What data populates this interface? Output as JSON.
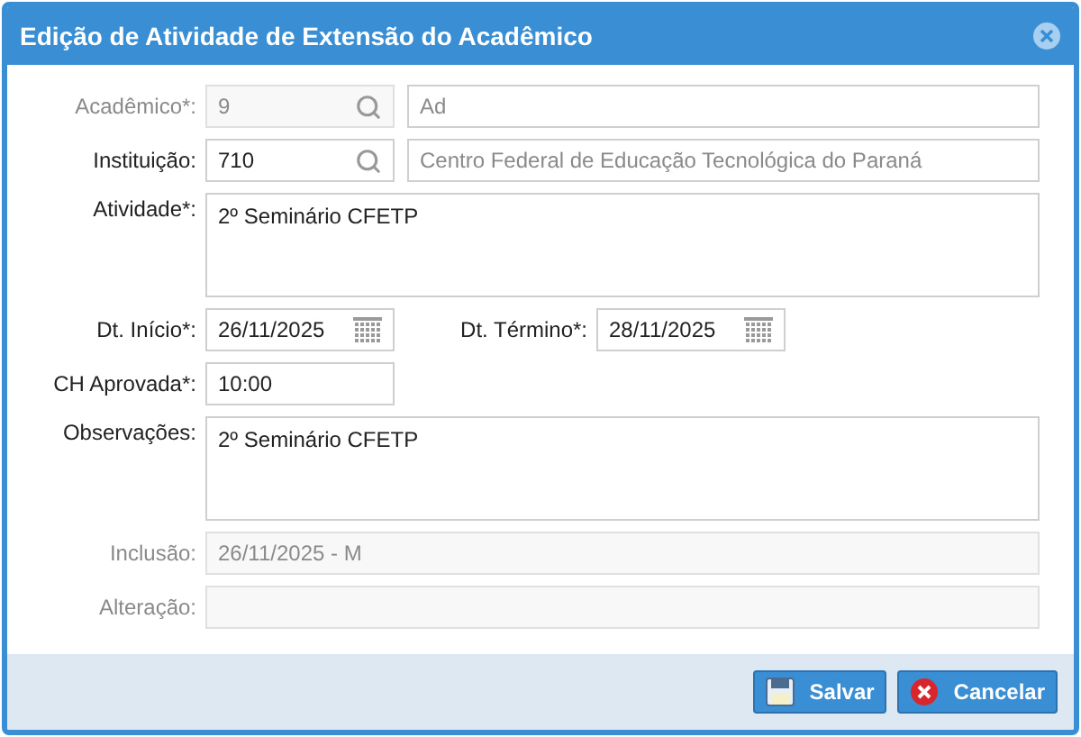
{
  "dialog": {
    "title": "Edição de Atividade de Extensão do Acadêmico"
  },
  "rows": [
    {
      "kind": "lookup",
      "label": "Acadêmico*:",
      "disabled": true,
      "code": "9",
      "name": "Ad"
    },
    {
      "kind": "lookup",
      "label": "Instituição:",
      "disabled": false,
      "code": "710",
      "name": "Centro Federal de Educação Tecnológica do Paraná"
    },
    {
      "kind": "textarea",
      "label": "Atividade*:",
      "disabled": false,
      "value": "2º Seminário CFETP"
    },
    {
      "kind": "dates",
      "fields": [
        {
          "label": "Dt. Início*:",
          "value": "26/11/2025"
        },
        {
          "label": "Dt. Término*:",
          "value": "28/11/2025"
        }
      ]
    },
    {
      "kind": "short_text",
      "label": "CH Aprovada*:",
      "disabled": false,
      "value": "10:00"
    },
    {
      "kind": "textarea",
      "label": "Observações:",
      "disabled": false,
      "value": "2º Seminário CFETP"
    },
    {
      "kind": "text",
      "label": "Inclusão:",
      "disabled": true,
      "value": "26/11/2025 - M"
    },
    {
      "kind": "text",
      "label": "Alteração:",
      "disabled": true
    }
  ],
  "buttons": [
    {
      "kind": "save",
      "label": "Salvar"
    },
    {
      "kind": "cancel",
      "label": "Cancelar"
    }
  ]
}
